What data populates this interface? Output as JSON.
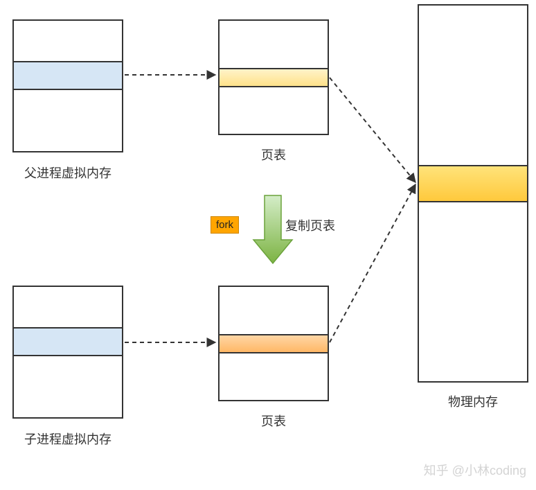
{
  "labels": {
    "parent_vm": "父进程虚拟内存",
    "child_vm": "子进程虚拟内存",
    "page_table_top": "页表",
    "page_table_bottom": "页表",
    "physical_mem": "物理内存",
    "fork_badge": "fork",
    "copy_pt": "复制页表",
    "watermark": "知乎 @小林coding"
  },
  "colors": {
    "vm_band": "#d6e6f5",
    "pt_top_band_start": "#fff3c9",
    "pt_top_band_end": "#ffe28a",
    "pt_bottom_band_start": "#ffd6a5",
    "pt_bottom_band_end": "#ffb866",
    "phys_band_start": "#ffe37a",
    "phys_band_end": "#ffc93c",
    "arrow_green_start": "#c8e6c9",
    "arrow_green_end": "#7cb342"
  }
}
